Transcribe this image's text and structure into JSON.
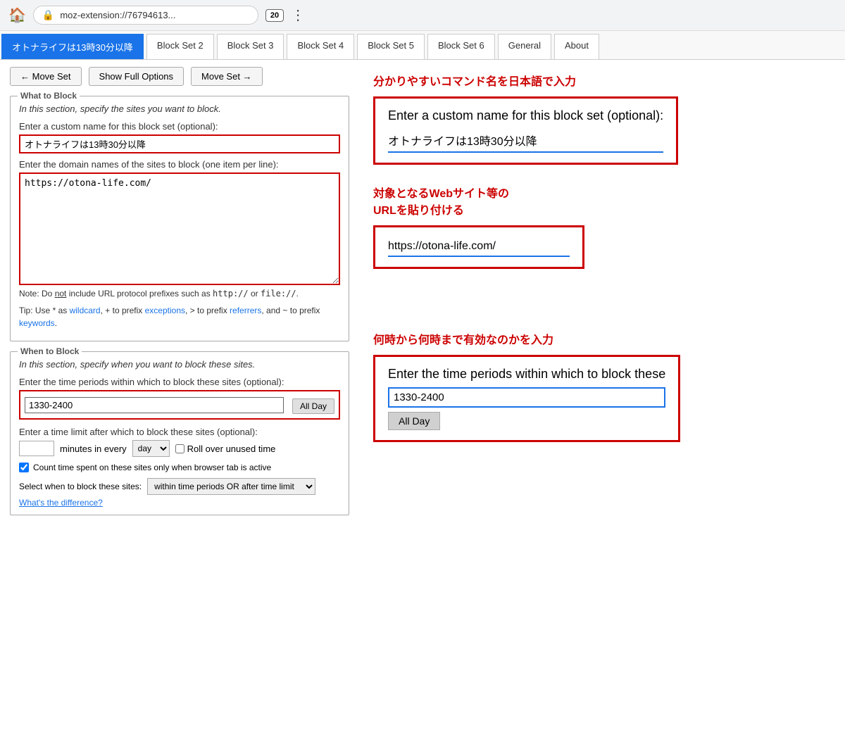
{
  "browser": {
    "address": "moz-extension://76794613...",
    "tab_count": "20"
  },
  "tabs": [
    {
      "label": "オトナライフは13時30分以降",
      "active": true
    },
    {
      "label": "Block Set 2",
      "active": false
    },
    {
      "label": "Block Set 3",
      "active": false
    },
    {
      "label": "Block Set 4",
      "active": false
    },
    {
      "label": "Block Set 5",
      "active": false
    },
    {
      "label": "Block Set 6",
      "active": false
    },
    {
      "label": "General",
      "active": false
    },
    {
      "label": "About",
      "active": false
    }
  ],
  "actions": {
    "move_left": "← Move Set",
    "show_options": "Show Full Options",
    "move_right": "Move Set →"
  },
  "what_to_block": {
    "section_title": "What to Block",
    "description": "In this section, specify the sites you want to block.",
    "custom_name_label": "Enter a custom name for this block set (optional):",
    "custom_name_value": "オトナライフは13時30分以降",
    "domain_label": "Enter the domain names of the sites to block (one item per line):",
    "domain_value": "https://otona-life.com/",
    "note": "Note: Do not include URL protocol prefixes such as http:// or file://.",
    "note_not": "not",
    "tip": "Tip: Use * as wildcard, + to prefix exceptions, > to prefix referrers, and ~ to prefix keywords",
    "wildcard_link": "wildcard",
    "exceptions_link": "exceptions",
    "referrers_link": "referrers",
    "keywords_link": "keywords"
  },
  "when_to_block": {
    "section_title": "When to Block",
    "description": "In this section, specify when you want to block these sites.",
    "time_period_label": "Enter the time periods within which to block these sites (optional):",
    "time_period_value": "1330-2400",
    "all_day_label": "All Day",
    "time_limit_label": "Enter a time limit after which to block these sites (optional):",
    "minutes_placeholder": "",
    "minutes_label": "minutes in every",
    "roll_over_label": "Roll over unused time",
    "count_time_label": "Count time spent on these sites only when browser tab is active",
    "select_label": "Select when to block these sites:",
    "select_value": "within time periods OR after time limit",
    "whats_difference": "What's the difference?"
  },
  "annotations": {
    "title1": "分かりやすいコマンド名を日本語で入力",
    "box1_label": "Enter a custom name for this block set (optional):",
    "box1_value": "オトナライフは13時30分以降",
    "title2_line1": "対象となるWebサイト等の",
    "title2_line2": "URLを貼り付ける",
    "box2_value": "https://otona-life.com/",
    "title3": "何時から何時まで有効なのかを入力",
    "box3_label": "Enter the time periods within which to block these",
    "box3_value": "1330-2400",
    "box3_allday": "All Day"
  }
}
